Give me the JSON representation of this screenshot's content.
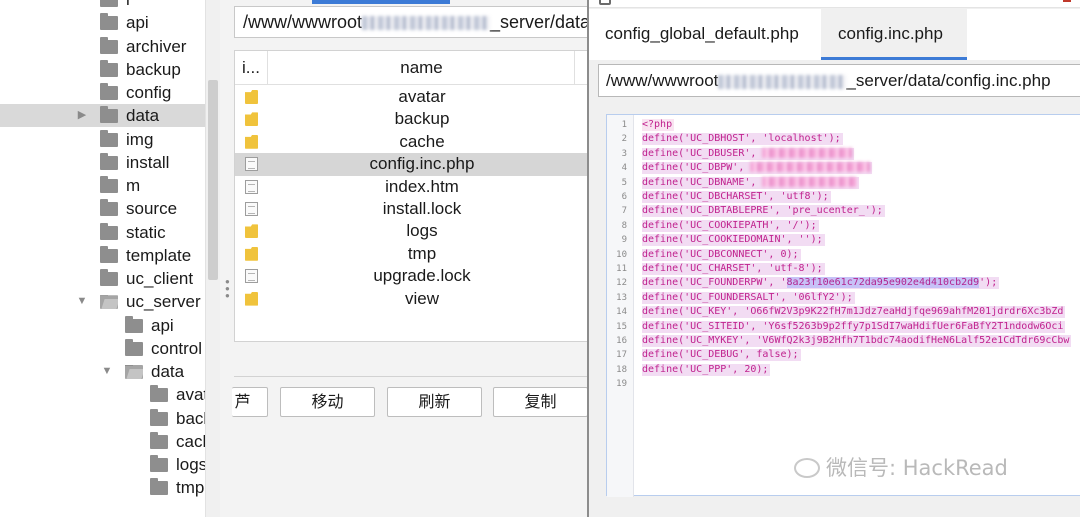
{
  "tree": {
    "items": [
      {
        "label": "i",
        "depth": 0,
        "expanded": false,
        "open": false,
        "selected": false
      },
      {
        "label": "api",
        "depth": 0,
        "expanded": false,
        "open": false,
        "selected": false
      },
      {
        "label": "archiver",
        "depth": 0,
        "expanded": false,
        "open": false,
        "selected": false
      },
      {
        "label": "backup",
        "depth": 0,
        "expanded": false,
        "open": false,
        "selected": false
      },
      {
        "label": "config",
        "depth": 0,
        "expanded": false,
        "open": false,
        "selected": false
      },
      {
        "label": "data",
        "depth": 0,
        "expanded": false,
        "open": false,
        "selected": true,
        "arrow": "▶"
      },
      {
        "label": "img",
        "depth": 0,
        "expanded": false,
        "open": false,
        "selected": false
      },
      {
        "label": "install",
        "depth": 0,
        "expanded": false,
        "open": false,
        "selected": false
      },
      {
        "label": "m",
        "depth": 0,
        "expanded": false,
        "open": false,
        "selected": false
      },
      {
        "label": "source",
        "depth": 0,
        "expanded": false,
        "open": false,
        "selected": false
      },
      {
        "label": "static",
        "depth": 0,
        "expanded": false,
        "open": false,
        "selected": false
      },
      {
        "label": "template",
        "depth": 0,
        "expanded": false,
        "open": false,
        "selected": false
      },
      {
        "label": "uc_client",
        "depth": 0,
        "expanded": false,
        "open": false,
        "selected": false
      },
      {
        "label": "uc_server",
        "depth": 0,
        "expanded": true,
        "open": true,
        "selected": false,
        "arrow": "▼"
      },
      {
        "label": "api",
        "depth": 1,
        "expanded": false,
        "open": false,
        "selected": false
      },
      {
        "label": "control",
        "depth": 1,
        "expanded": false,
        "open": false,
        "selected": false
      },
      {
        "label": "data",
        "depth": 1,
        "expanded": true,
        "open": true,
        "selected": false,
        "arrow": "▼"
      },
      {
        "label": "avat",
        "depth": 2,
        "expanded": false,
        "open": false,
        "selected": false
      },
      {
        "label": "bacl",
        "depth": 2,
        "expanded": false,
        "open": false,
        "selected": false
      },
      {
        "label": "cach",
        "depth": 2,
        "expanded": false,
        "open": false,
        "selected": false
      },
      {
        "label": "logs",
        "depth": 2,
        "expanded": false,
        "open": false,
        "selected": false
      },
      {
        "label": "tmp",
        "depth": 2,
        "expanded": false,
        "open": false,
        "selected": false
      }
    ]
  },
  "middle": {
    "path_prefix": "/www/wwwroot",
    "path_suffix": "_server/data/",
    "columns": [
      "i...",
      "name"
    ],
    "files": [
      {
        "name": "avatar",
        "type": "folder",
        "selected": false
      },
      {
        "name": "backup",
        "type": "folder",
        "selected": false
      },
      {
        "name": "cache",
        "type": "folder",
        "selected": false
      },
      {
        "name": "config.inc.php",
        "type": "file",
        "selected": true
      },
      {
        "name": "index.htm",
        "type": "file",
        "selected": false
      },
      {
        "name": "install.lock",
        "type": "file",
        "selected": false
      },
      {
        "name": "logs",
        "type": "folder",
        "selected": false
      },
      {
        "name": "tmp",
        "type": "folder",
        "selected": false
      },
      {
        "name": "upgrade.lock",
        "type": "file",
        "selected": false
      },
      {
        "name": "view",
        "type": "folder",
        "selected": false
      }
    ],
    "buttons": {
      "partial": "芦",
      "move": "移动",
      "refresh": "刷新",
      "copy": "复制"
    }
  },
  "editor": {
    "tabs": [
      {
        "label": "config_global_default.php",
        "active": false
      },
      {
        "label": "config.inc.php",
        "active": true
      }
    ],
    "path_prefix": "/www/wwwroot",
    "path_suffix": "_server/data/config.inc.php",
    "lines": [
      {
        "n": "1",
        "text": "<?php"
      },
      {
        "n": "2",
        "text": "define('UC_DBHOST', 'localhost');"
      },
      {
        "n": "3",
        "text": "define('UC_DBUSER', "
      },
      {
        "n": "4",
        "text": "define('UC_DBPW', "
      },
      {
        "n": "5",
        "text": "define('UC_DBNAME', "
      },
      {
        "n": "6",
        "text": "define('UC_DBCHARSET', 'utf8');"
      },
      {
        "n": "7",
        "text": "define('UC_DBTABLEPRE', 'pre_ucenter_');"
      },
      {
        "n": "8",
        "text": "define('UC_COOKIEPATH', '/');"
      },
      {
        "n": "9",
        "text": "define('UC_COOKIEDOMAIN', '');"
      },
      {
        "n": "10",
        "text": "define('UC_DBCONNECT', 0);"
      },
      {
        "n": "11",
        "text": "define('UC_CHARSET', 'utf-8');"
      },
      {
        "n": "12",
        "text": "define('UC_FOUNDERPW', '",
        "highlight": "8a23f10e61c72da95e902e4d410cb2d9",
        "tail": "');"
      },
      {
        "n": "13",
        "text": "define('UC_FOUNDERSALT', '06lfY2');"
      },
      {
        "n": "14",
        "text": "define('UC_KEY', 'O66fW2V3p9K22fH7m1Jdz7eaHdjfqe969ahfM201jdrdr6Xc3bZd"
      },
      {
        "n": "15",
        "text": "define('UC_SITEID', 'Y6sf5263b9p2ffy7p1SdI7waHdifUer6FaBfY2T1ndodw6Oci"
      },
      {
        "n": "16",
        "text": "define('UC_MYKEY', 'V6WfQ2k3j9B2Hfh7T1bdc74aodifHeN6Lalf52e1CdTdr69cCbw"
      },
      {
        "n": "17",
        "text": "define('UC_DEBUG', false);"
      },
      {
        "n": "18",
        "text": "define('UC_PPP', 20);"
      },
      {
        "n": "19",
        "text": ""
      }
    ]
  },
  "watermark": "微信号: HackRead"
}
